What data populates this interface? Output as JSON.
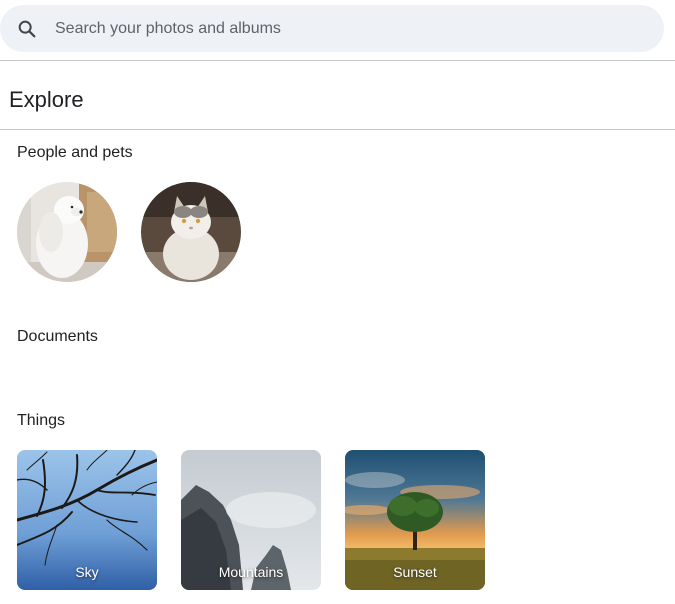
{
  "search": {
    "placeholder": "Search your photos and albums",
    "icon": "search-icon"
  },
  "explore": {
    "title": "Explore"
  },
  "sections": {
    "people": {
      "title": "People and pets",
      "items": [
        {
          "name": "dog",
          "image": "white-dog-photo"
        },
        {
          "name": "cat",
          "image": "fluffy-cat-photo"
        }
      ]
    },
    "documents": {
      "title": "Documents"
    },
    "things": {
      "title": "Things",
      "items": [
        {
          "label": "Sky"
        },
        {
          "label": "Mountains"
        },
        {
          "label": "Sunset"
        }
      ]
    }
  },
  "colors": {
    "search_bg": "#eef1f6",
    "divider": "#c4c7c5",
    "text": "#202124"
  }
}
